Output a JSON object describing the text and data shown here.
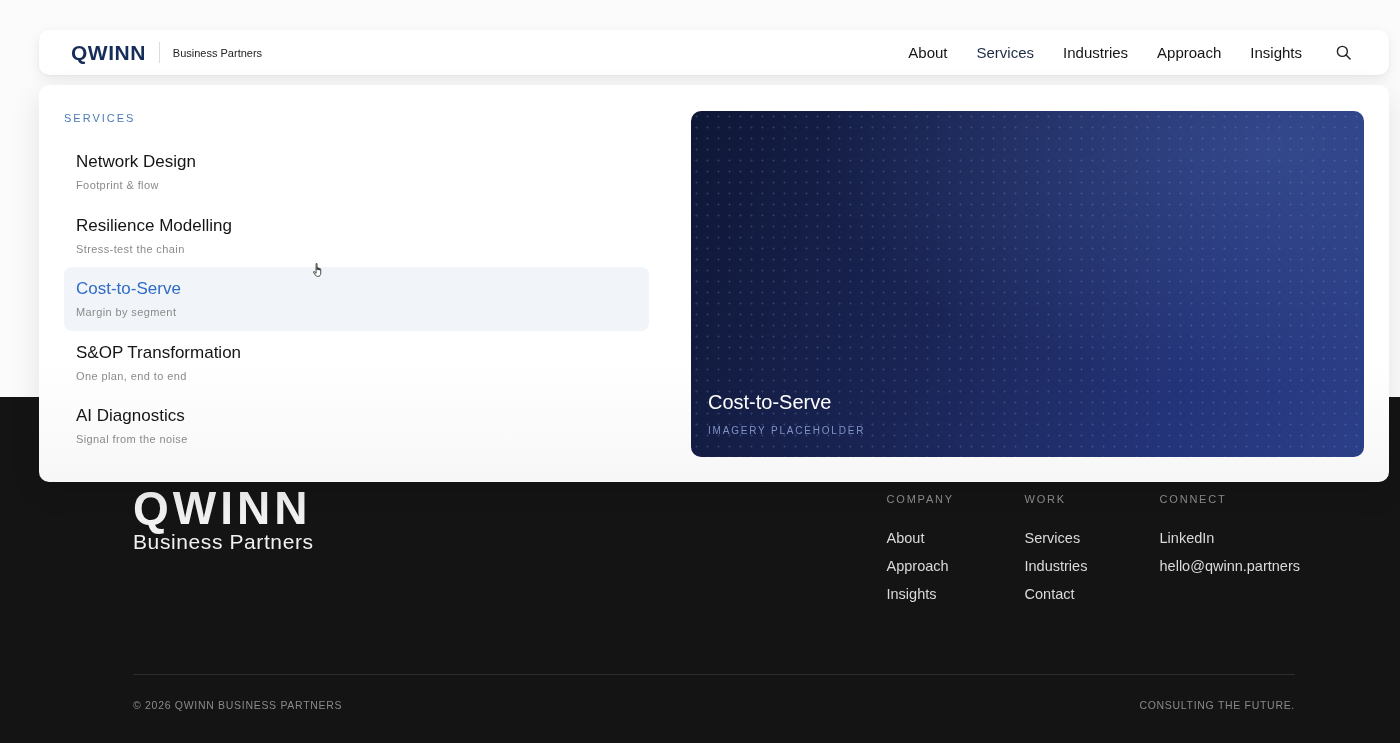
{
  "header": {
    "logo": "QWINN",
    "tagline": "Business Partners",
    "nav": [
      {
        "label": "About",
        "selected": false
      },
      {
        "label": "Services",
        "selected": true
      },
      {
        "label": "Industries",
        "selected": false
      },
      {
        "label": "Approach",
        "selected": false
      },
      {
        "label": "Insights",
        "selected": false
      }
    ]
  },
  "mega_menu": {
    "heading": "SERVICES",
    "items": [
      {
        "title": "Network Design",
        "subtitle": "Footprint & flow",
        "selected": false
      },
      {
        "title": "Resilience Modelling",
        "subtitle": "Stress-test the chain",
        "selected": false
      },
      {
        "title": "Cost-to-Serve",
        "subtitle": "Margin by segment",
        "selected": true
      },
      {
        "title": "S&OP Transformation",
        "subtitle": "One plan, end to end",
        "selected": false
      },
      {
        "title": "AI Diagnostics",
        "subtitle": "Signal from the noise",
        "selected": false
      }
    ],
    "preview": {
      "title": "Cost-to-Serve",
      "caption": "IMAGERY PLACEHOLDER"
    }
  },
  "footer": {
    "logo": "QWINN",
    "tagline": "Business Partners",
    "columns": [
      {
        "heading": "COMPANY",
        "links": [
          "About",
          "Approach",
          "Insights"
        ]
      },
      {
        "heading": "WORK",
        "links": [
          "Services",
          "Industries",
          "Contact"
        ]
      },
      {
        "heading": "CONNECT",
        "links": [
          "LinkedIn",
          "hello@qwinn.partners"
        ]
      }
    ],
    "copyright": "© 2026 QWINN BUSINESS PARTNERS",
    "slogan": "CONSULTING THE FUTURE."
  }
}
